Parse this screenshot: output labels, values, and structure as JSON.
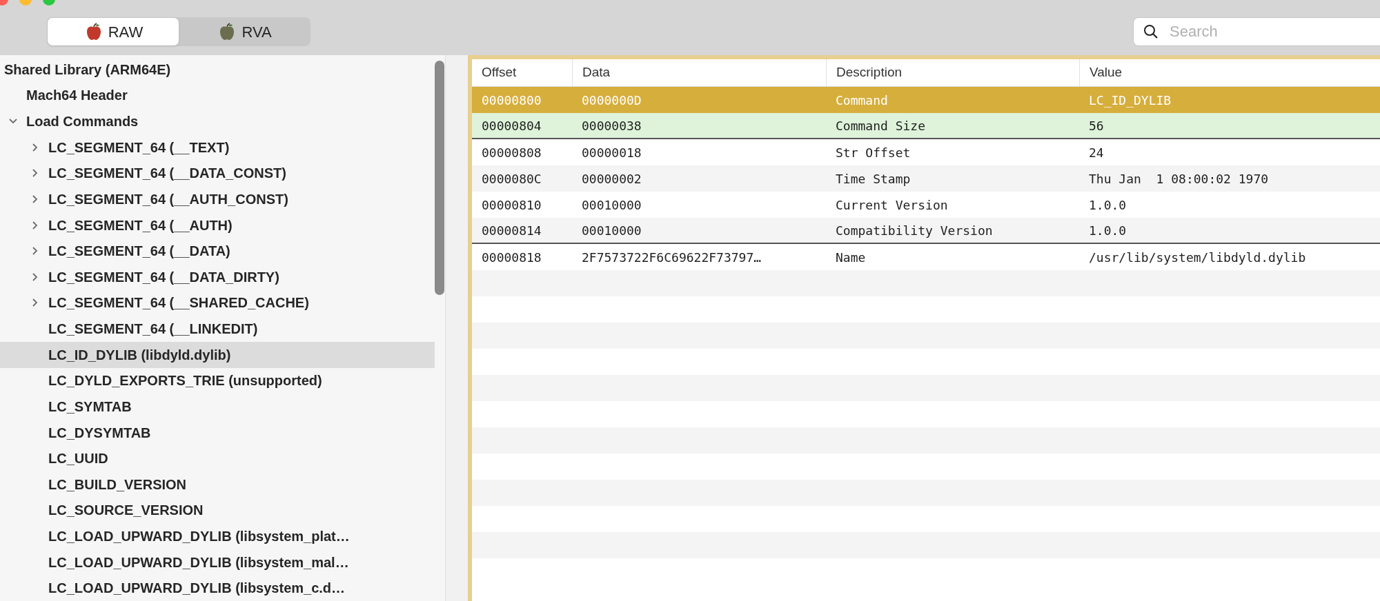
{
  "toolbar": {
    "view_modes": [
      {
        "label": "RAW",
        "selected": true
      },
      {
        "label": "RVA",
        "selected": false
      }
    ],
    "search": {
      "placeholder": "Search"
    }
  },
  "tree": [
    {
      "label": "Shared Library  (ARM64E)",
      "selected": false,
      "children": [
        {
          "label": "Mach64 Header",
          "selected": false
        },
        {
          "label": "Load Commands",
          "selected": false,
          "expanded": true,
          "children": [
            {
              "label": "LC_SEGMENT_64 (__TEXT)",
              "selected": false,
              "expanded": false
            },
            {
              "label": "LC_SEGMENT_64 (__DATA_CONST)",
              "selected": false,
              "expanded": false
            },
            {
              "label": "LC_SEGMENT_64 (__AUTH_CONST)",
              "selected": false,
              "expanded": false
            },
            {
              "label": "LC_SEGMENT_64 (__AUTH)",
              "selected": false,
              "expanded": false
            },
            {
              "label": "LC_SEGMENT_64 (__DATA)",
              "selected": false,
              "expanded": false
            },
            {
              "label": "LC_SEGMENT_64 (__DATA_DIRTY)",
              "selected": false,
              "expanded": false
            },
            {
              "label": "LC_SEGMENT_64 (__SHARED_CACHE)",
              "selected": false,
              "expanded": false
            },
            {
              "label": "LC_SEGMENT_64 (__LINKEDIT)",
              "selected": false
            },
            {
              "label": "LC_ID_DYLIB (libdyld.dylib)",
              "selected": true
            },
            {
              "label": "LC_DYLD_EXPORTS_TRIE (unsupported)",
              "selected": false
            },
            {
              "label": "LC_SYMTAB",
              "selected": false
            },
            {
              "label": "LC_DYSYMTAB",
              "selected": false
            },
            {
              "label": "LC_UUID",
              "selected": false
            },
            {
              "label": "LC_BUILD_VERSION",
              "selected": false
            },
            {
              "label": "LC_SOURCE_VERSION",
              "selected": false
            },
            {
              "label": "LC_LOAD_UPWARD_DYLIB (libsystem_plat…",
              "selected": false
            },
            {
              "label": "LC_LOAD_UPWARD_DYLIB (libsystem_mal…",
              "selected": false
            },
            {
              "label": "LC_LOAD_UPWARD_DYLIB (libsystem_c.d…",
              "selected": false
            }
          ]
        }
      ]
    }
  ],
  "table": {
    "columns": [
      "Offset",
      "Data",
      "Description",
      "Value"
    ],
    "rows": [
      {
        "cells": [
          "00000800",
          "0000000D",
          "Command",
          "LC_ID_DYLIB"
        ],
        "selected": true,
        "marked": false,
        "divider_below": false
      },
      {
        "cells": [
          "00000804",
          "00000038",
          "Command Size",
          "56"
        ],
        "selected": false,
        "marked": true,
        "divider_below": true
      },
      {
        "cells": [
          "00000808",
          "00000018",
          "Str Offset",
          "24"
        ],
        "selected": false,
        "marked": false,
        "divider_below": false
      },
      {
        "cells": [
          "0000080C",
          "00000002",
          "Time Stamp",
          "Thu Jan  1 08:00:02 1970"
        ],
        "selected": false,
        "marked": false,
        "divider_below": false
      },
      {
        "cells": [
          "00000810",
          "00010000",
          "Current Version",
          "1.0.0"
        ],
        "selected": false,
        "marked": false,
        "divider_below": false
      },
      {
        "cells": [
          "00000814",
          "00010000",
          "Compatibility Version",
          "1.0.0"
        ],
        "selected": false,
        "marked": false,
        "divider_below": true
      },
      {
        "cells": [
          "00000818",
          "2F7573722F6C69622F73797…",
          "Name",
          "/usr/lib/system/libdyld.dylib"
        ],
        "selected": false,
        "marked": false,
        "divider_below": false
      }
    ]
  }
}
